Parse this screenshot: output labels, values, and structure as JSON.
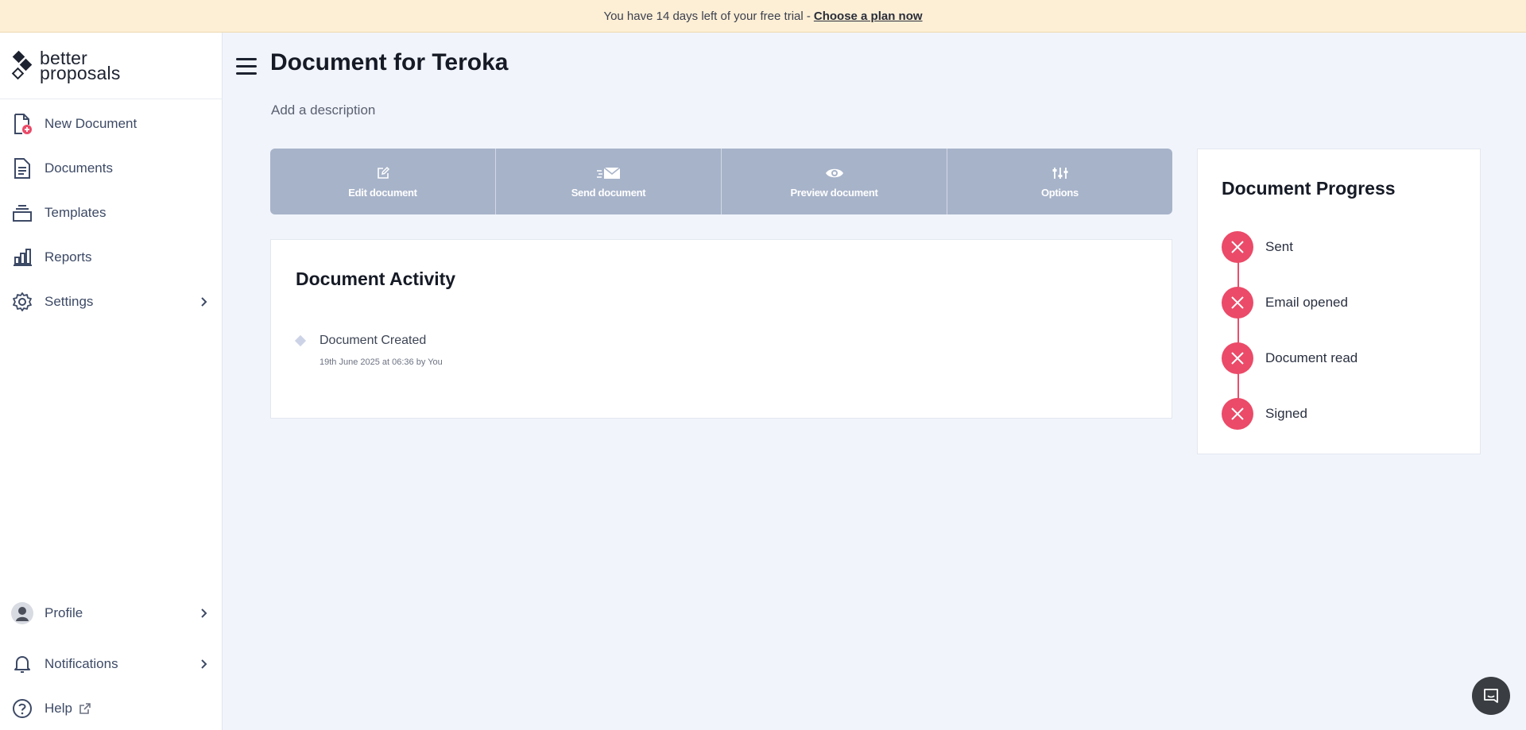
{
  "banner": {
    "text": "You have 14 days left of your free trial - ",
    "link": "Choose a plan now"
  },
  "logo": {
    "line1": "better",
    "line2": "proposals"
  },
  "sidebar": {
    "items": [
      {
        "label": "New Document",
        "icon": "new-document-icon"
      },
      {
        "label": "Documents",
        "icon": "documents-icon"
      },
      {
        "label": "Templates",
        "icon": "templates-icon"
      },
      {
        "label": "Reports",
        "icon": "reports-icon"
      },
      {
        "label": "Settings",
        "icon": "gear-icon"
      }
    ],
    "bottom": [
      {
        "label": "Profile",
        "icon": "avatar"
      },
      {
        "label": "Notifications",
        "icon": "bell-icon"
      },
      {
        "label": "Help",
        "icon": "help-icon"
      }
    ]
  },
  "page": {
    "title": "Document for Teroka",
    "description_placeholder": "Add a description"
  },
  "actions": [
    {
      "label": "Edit document",
      "icon": "edit-icon"
    },
    {
      "label": "Send document",
      "icon": "send-mail-icon"
    },
    {
      "label": "Preview document",
      "icon": "eye-icon"
    },
    {
      "label": "Options",
      "icon": "sliders-icon"
    }
  ],
  "activity": {
    "title": "Document Activity",
    "items": [
      {
        "title": "Document Created",
        "meta": "19th June 2025 at 06:36 by You"
      }
    ]
  },
  "progress": {
    "title": "Document Progress",
    "steps": [
      {
        "label": "Sent",
        "status": "not-done"
      },
      {
        "label": "Email opened",
        "status": "not-done"
      },
      {
        "label": "Document read",
        "status": "not-done"
      },
      {
        "label": "Signed",
        "status": "not-done"
      }
    ]
  },
  "colors": {
    "accent_red": "#eb4a68",
    "action_bar": "#a7b3c9",
    "banner_bg": "#fdefd5",
    "page_bg": "#f1f4fb"
  }
}
